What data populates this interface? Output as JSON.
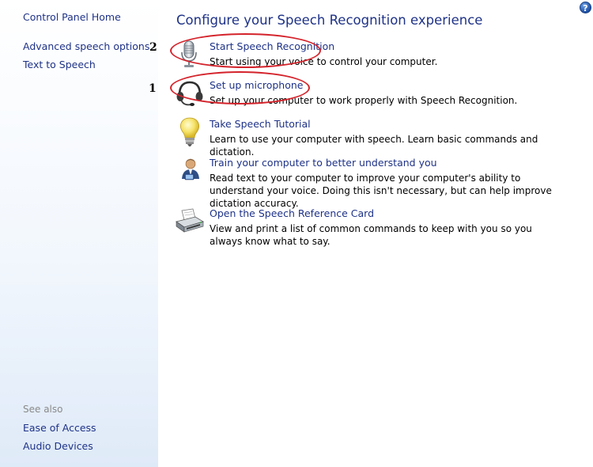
{
  "sidebar": {
    "home": "Control Panel Home",
    "links": [
      "Advanced speech options",
      "Text to Speech"
    ],
    "see_also_label": "See also",
    "see_also": [
      "Ease of Access",
      "Audio Devices"
    ]
  },
  "main": {
    "title": "Configure your Speech Recognition experience",
    "help": "?",
    "tasks": [
      {
        "link": "Start Speech Recognition",
        "desc": "Start using your voice to control your computer.",
        "icon": "microphone-icon"
      },
      {
        "link": "Set up microphone",
        "desc": "Set up your computer to work properly with Speech Recognition.",
        "icon": "headset-icon"
      },
      {
        "link": "Take Speech Tutorial",
        "desc": "Learn to use your computer with speech.  Learn basic commands and dictation.",
        "icon": "lightbulb-icon"
      },
      {
        "link": "Train your computer to better understand you",
        "desc": "Read text to your computer to improve your computer's ability to understand your voice.  Doing this isn't necessary, but can help improve dictation accuracy.",
        "icon": "user-icon"
      },
      {
        "link": "Open the Speech Reference Card",
        "desc": "View and print a list of common commands to keep with you so you always know what to say.",
        "icon": "printer-icon"
      }
    ]
  },
  "annotations": [
    "2",
    "1"
  ],
  "colors": {
    "link": "#1e3287",
    "annotation": "#d4232b",
    "sidebar_bottom": "#dfeaf8"
  }
}
